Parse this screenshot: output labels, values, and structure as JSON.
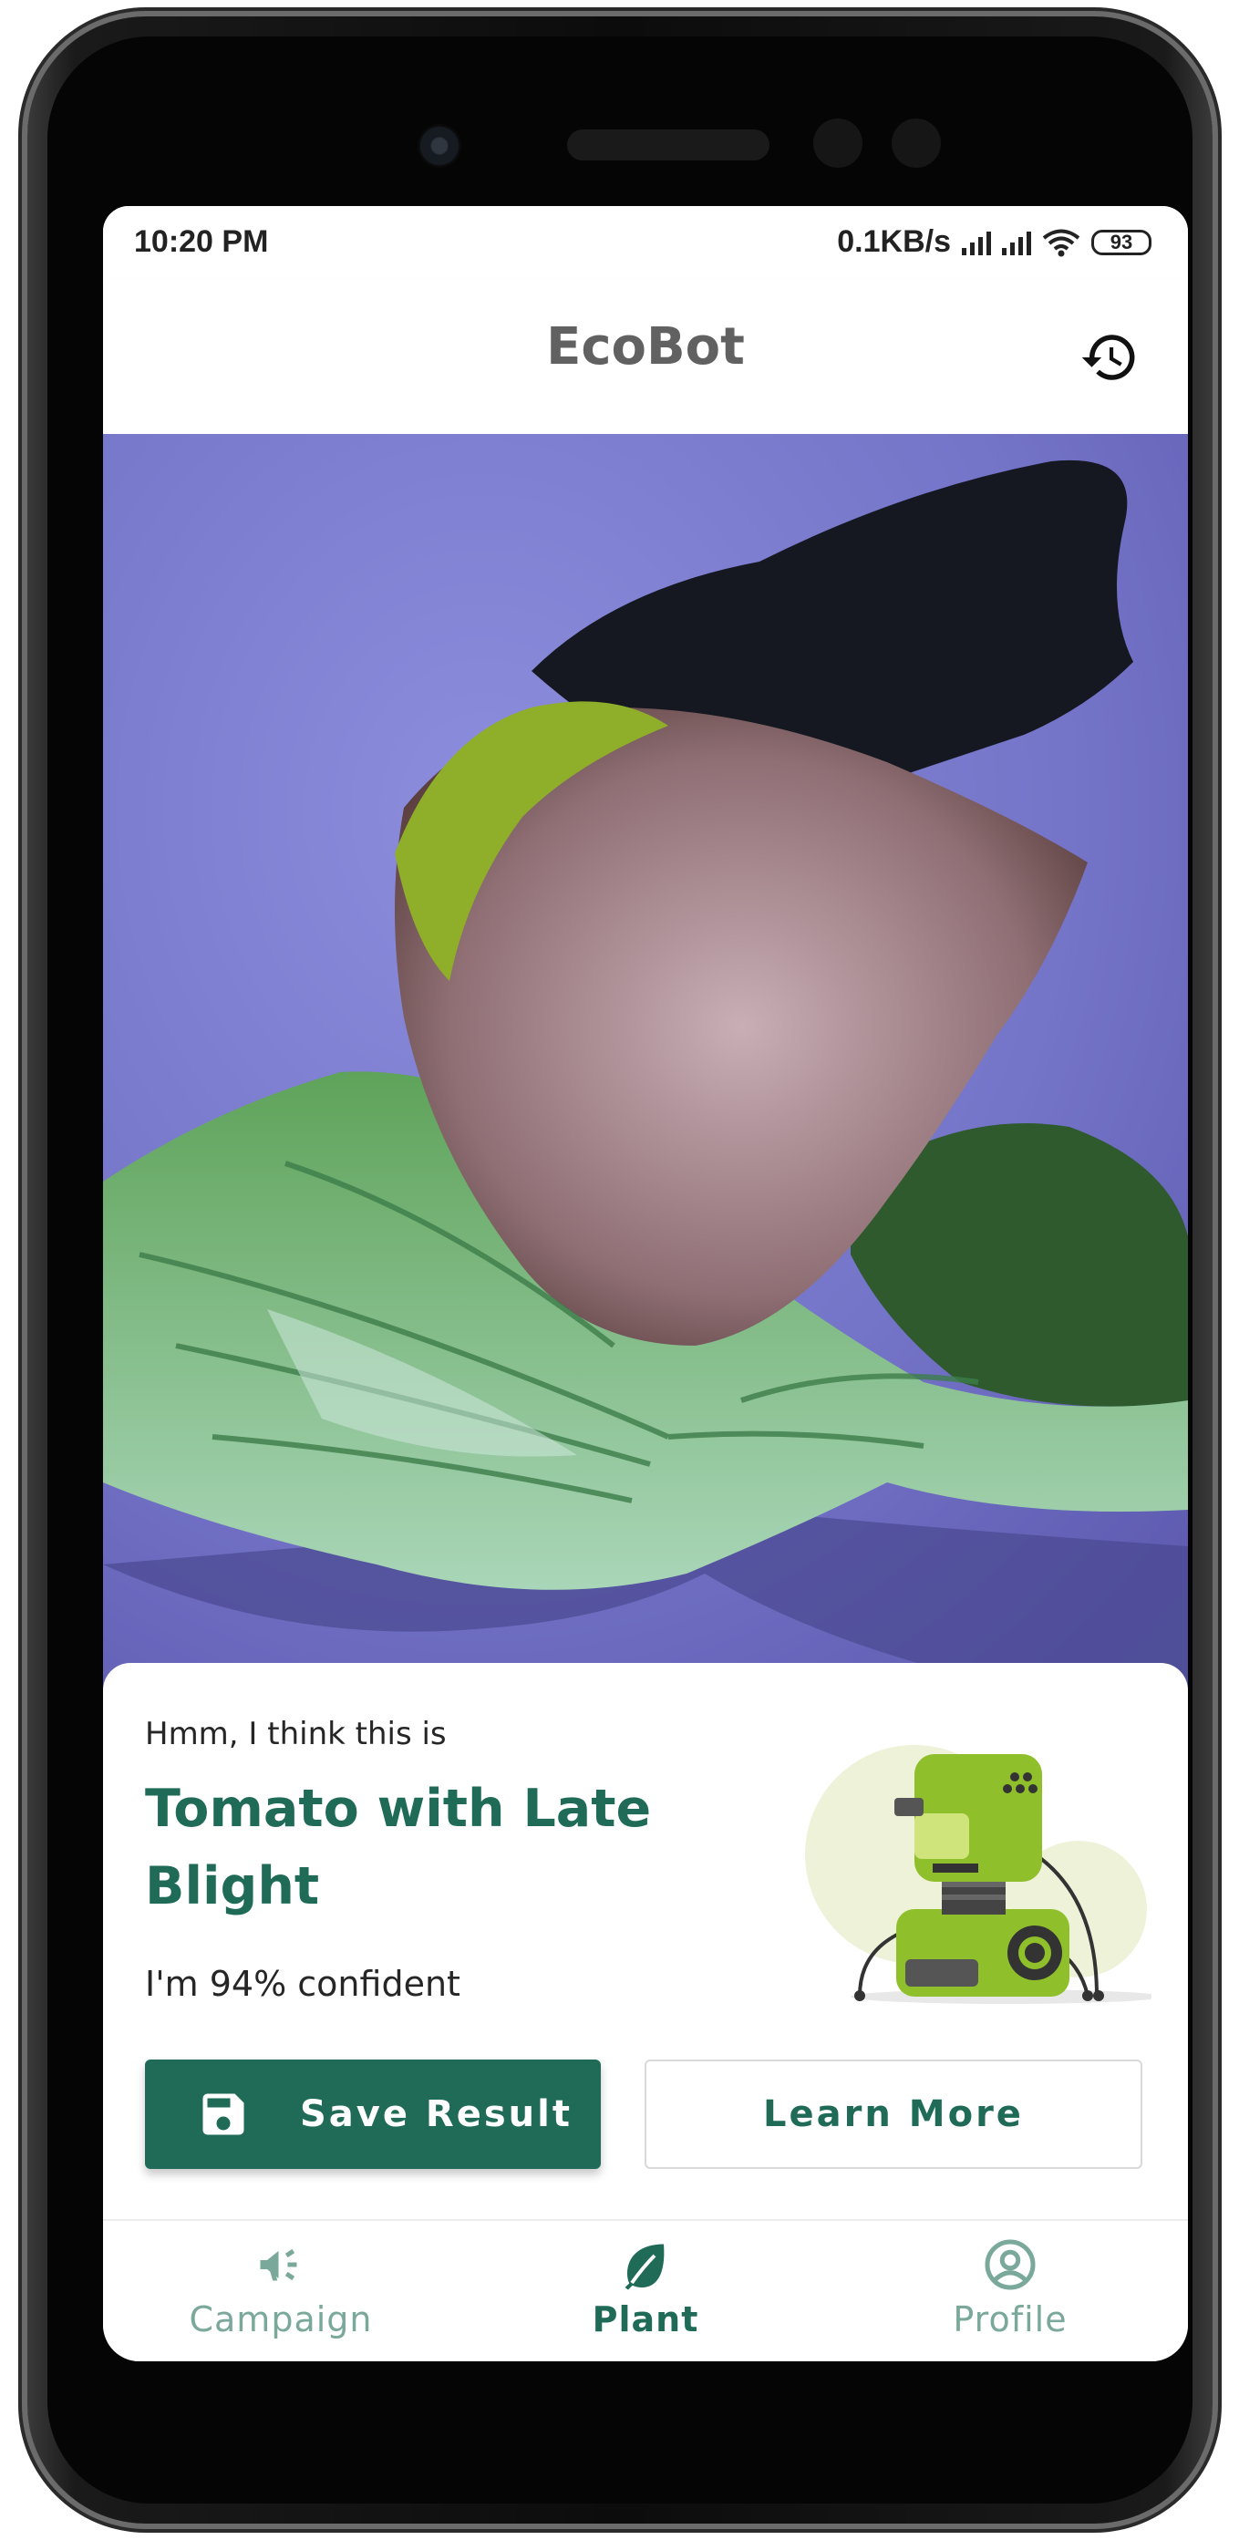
{
  "status_bar": {
    "time": "10:20 PM",
    "net_speed": "0.1KB/s",
    "battery": "93"
  },
  "app_bar": {
    "title": "EcoBot",
    "history_icon": "history-icon"
  },
  "result": {
    "hint": "Hmm, I think this is",
    "diagnosis": "Tomato with Late Blight",
    "confidence": "I'm 94% confident",
    "illustration": "robot-illustration"
  },
  "actions": {
    "save_label": "Save Result",
    "save_icon": "floppy-disk-icon",
    "learn_more_label": "Learn More"
  },
  "bottom_nav": {
    "items": [
      {
        "label": "Campaign",
        "icon": "megaphone-icon",
        "active": false
      },
      {
        "label": "Plant",
        "icon": "leaf-icon",
        "active": true
      },
      {
        "label": "Profile",
        "icon": "user-circle-icon",
        "active": false
      }
    ]
  },
  "colors": {
    "primary": "#1f6b57",
    "inactive_nav": "#7aa89b",
    "title_gray": "#616161"
  }
}
